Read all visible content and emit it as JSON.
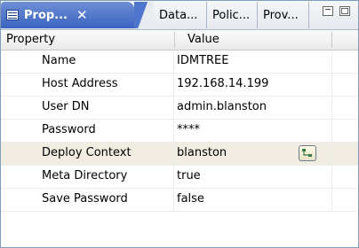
{
  "tabs": [
    {
      "label": "Prop...",
      "active": true,
      "close": "✕"
    },
    {
      "label": "Data...",
      "active": false
    },
    {
      "label": "Polic...",
      "active": false
    },
    {
      "label": "Prov...",
      "active": false
    }
  ],
  "table": {
    "headers": [
      "Property",
      "Value"
    ],
    "rows": [
      {
        "name": "Name",
        "value": "IDMTREE"
      },
      {
        "name": "Host Address",
        "value": "192.168.14.199"
      },
      {
        "name": "User DN",
        "value": "admin.blanston"
      },
      {
        "name": "Password",
        "value": "****"
      },
      {
        "name": "Deploy Context",
        "value": "blanston",
        "selected": true
      },
      {
        "name": "Meta Directory",
        "value": "true"
      },
      {
        "name": "Save Password",
        "value": "false"
      }
    ]
  },
  "icons": {
    "tab_icon": "properties-list-icon",
    "context_button_icon": "browse-tree-icon",
    "minimize": "minimize-icon",
    "maximize": "maximize-icon"
  },
  "colors": {
    "active_tab": "#3a63c0",
    "selected_row": "#f0ece1"
  }
}
